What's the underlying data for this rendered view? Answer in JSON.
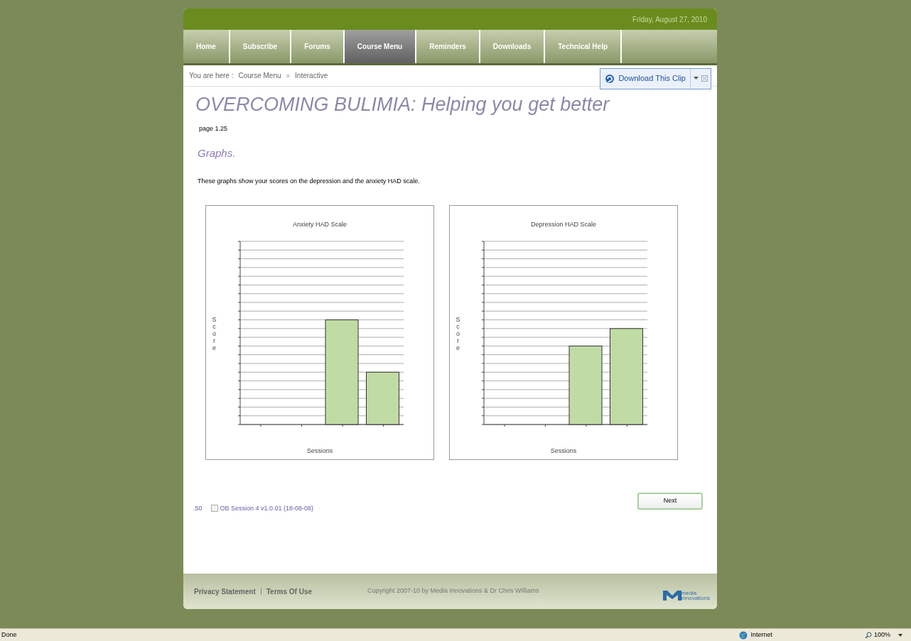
{
  "header": {
    "date": "Friday, August 27, 2010"
  },
  "nav": [
    {
      "label": "Home",
      "selected": false
    },
    {
      "label": "Subscribe",
      "selected": false
    },
    {
      "label": "Forums",
      "selected": false
    },
    {
      "label": "Course Menu",
      "selected": true
    },
    {
      "label": "Reminders",
      "selected": false
    },
    {
      "label": "Downloads",
      "selected": false
    },
    {
      "label": "Technical Help",
      "selected": false
    }
  ],
  "breadcrumb": {
    "prefix": "You are here :",
    "items": [
      "Course Menu",
      "Interactive"
    ],
    "separator": "»"
  },
  "download_clip": {
    "label": "Download This Clip"
  },
  "title": "OVERCOMING BULIMIA: Helping you get better",
  "page_number": "page 1.25",
  "section_heading": "Graphs.",
  "intro": "These graphs show your scores on the depression and the anxiety HAD scale.",
  "charts": [
    {
      "title": "Anxiety HAD Scale",
      "ylabel": "Score",
      "xlabel": "Sessions"
    },
    {
      "title": "Depression HAD Scale",
      "ylabel": "Score",
      "xlabel": "Sessions"
    }
  ],
  "next_button": "Next",
  "session": {
    "code": ".50",
    "label": "OB Session 4 v1.0.01 (18-08-08)",
    "checked": false
  },
  "footer": {
    "links": [
      "Privacy Statement",
      "Terms Of Use"
    ],
    "copyright": "Copyright 2007-10 by Media Innovations & Dr Chris Williams",
    "logo_top": "media",
    "logo_bottom": "innovations"
  },
  "status_bar": {
    "status": "Done",
    "zone": "Internet",
    "zoom": "100%"
  }
}
